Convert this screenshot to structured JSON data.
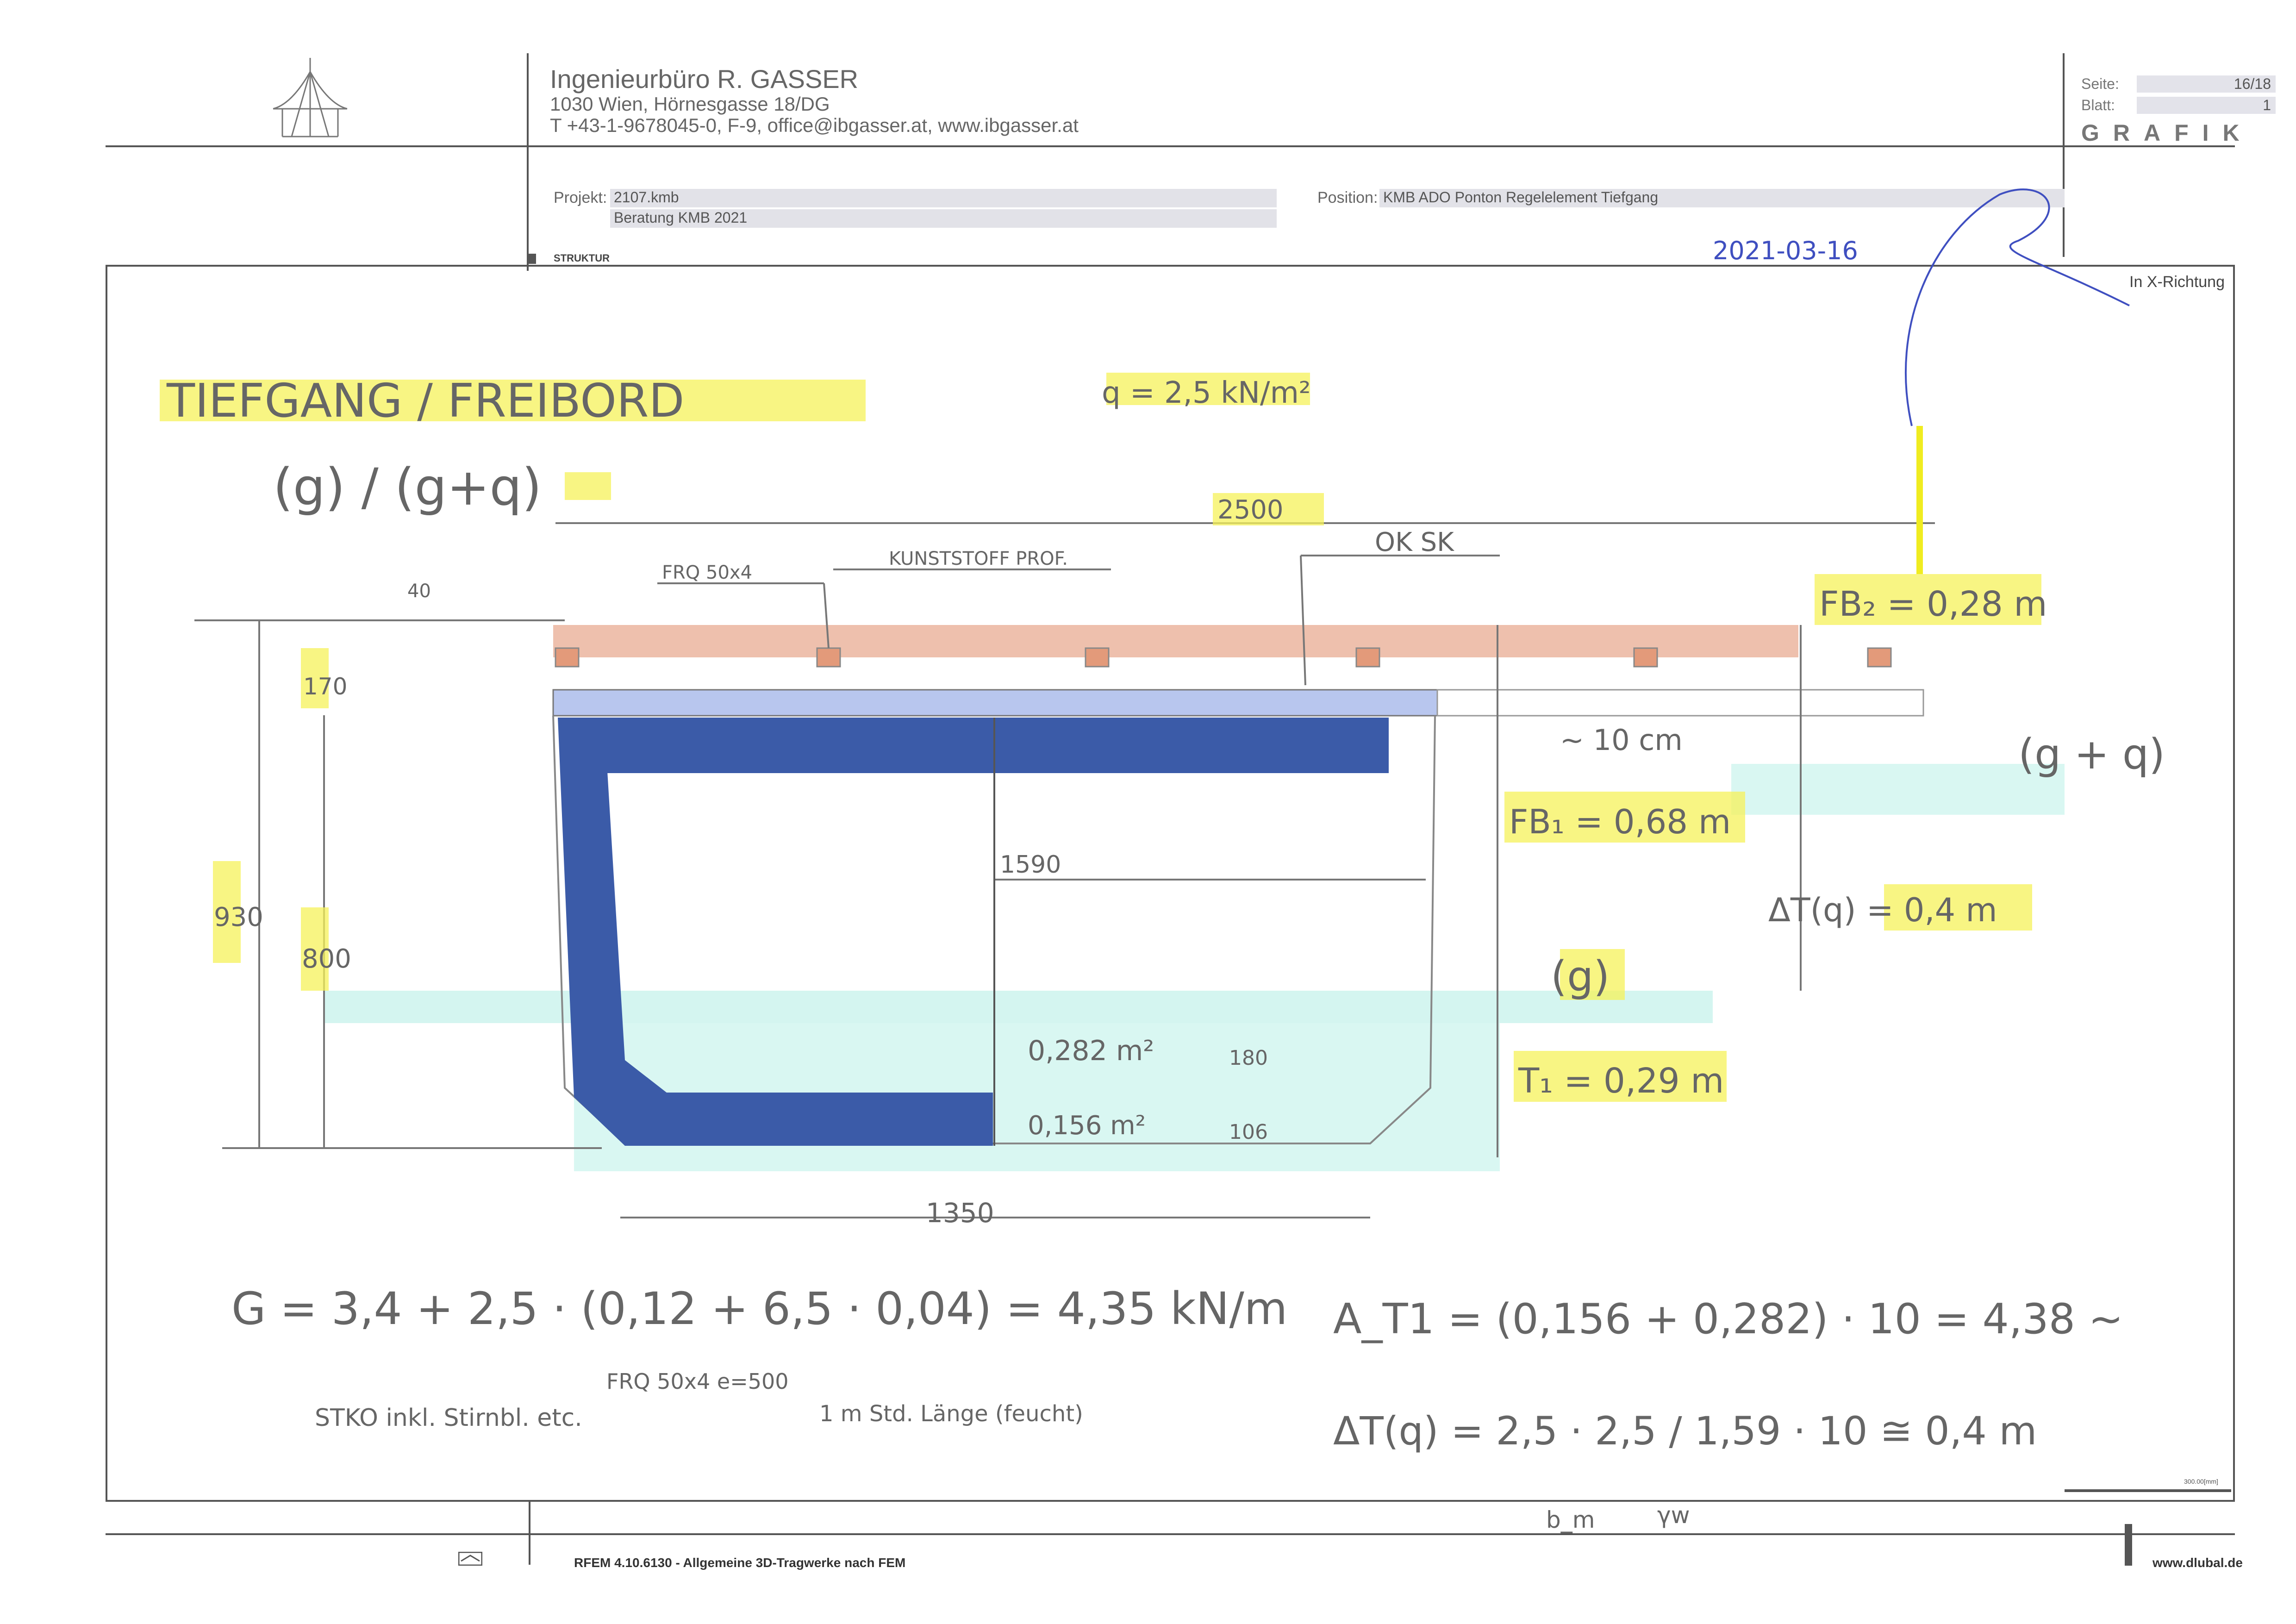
{
  "header": {
    "company_name": "Ingenieurbüro R. GASSER",
    "address": "1030 Wien, Hörnesgasse 18/DG",
    "contact": "T +43-1-9678045-0,  F-9,  office@ibgasser.at,  www.ibgasser.at",
    "page_label": "Seite:",
    "page_value": "16/18",
    "sheet_label": "Blatt:",
    "sheet_value": "1",
    "section": "GRAFIK"
  },
  "project": {
    "label": "Projekt:",
    "number": "2107.kmb",
    "name": "Beratung KMB 2021",
    "position_label": "Position:",
    "position": "KMB ADO Ponton Regelelement Tiefgang"
  },
  "frame": {
    "struktur_label": "STRUKTUR",
    "direction": "In X-Richtung",
    "scale": "300.00[mm]"
  },
  "sketch": {
    "date": "2021-03-16",
    "title": "TIEFGANG / FREIBORD",
    "subtitle": "(g) / (g+q)",
    "load": "q = 2,5 kN/m²",
    "width_total": "2500",
    "deck_profile": "FRQ 50x4",
    "plastic_profile": "KUNSTSTOFF PROF.",
    "ok_label": "OK SK",
    "dim_40": "40",
    "dim_170": "170",
    "dim_930": "930",
    "dim_800": "800",
    "dim_1590": "1590",
    "dim_1350": "1350",
    "dim_180": "180",
    "dim_106": "106",
    "approx_10cm": "~ 10 cm",
    "area_1": "0,282 m²",
    "area_2": "0,156 m²",
    "fb2": "FB₂ = 0,28 m",
    "fb1": "FB₁ = 0,68 m",
    "delta_t": "ΔT(q) = 0,4 m",
    "t1": "T₁ = 0,29 m",
    "g_label": "(g)",
    "gq_label": "(g + q)",
    "eq_g": "G = 3,4 + 2,5 · (0,12 + 6,5 · 0,04) = 4,35 kN/m",
    "eq_g_note1": "STKO inkl. Stirnbl. etc.",
    "eq_g_note2": "FRQ 50x4 e=500",
    "eq_g_note3": "1 m Std. Länge (feucht)",
    "eq_a": "A_T1 = (0,156 + 0,282) · 10 = 4,38 ~",
    "eq_dt": "ΔT(q) = 2,5 · 2,5 / 1,59 · 10 ≅ 0,4 m",
    "eq_dt_note1": "b_m",
    "eq_dt_note2": "γw"
  },
  "footer": {
    "software": "RFEM 4.10.6130 - Allgemeine 3D-Tragwerke nach FEM",
    "url": "www.dlubal.de"
  },
  "colors": {
    "steel_blue": "#3b5ba8",
    "deck_light_blue": "#b8c6ee",
    "wood_salmon": "#eec0ad",
    "water_cyan": "#c9f3ec",
    "highlight_yellow": "#f5f25a",
    "signature_blue": "#3f4fc0"
  }
}
